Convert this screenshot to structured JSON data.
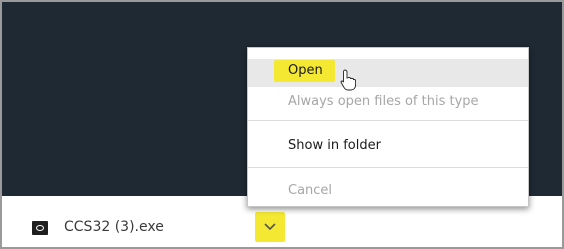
{
  "download": {
    "file_name": "CCS32 (3).exe",
    "file_icon": "exe-file-icon",
    "menu_toggle_icon": "chevron-down-icon"
  },
  "context_menu": {
    "open_label": "Open",
    "always_open_label": "Always open files of this type",
    "show_in_folder_label": "Show in folder",
    "cancel_label": "Cancel"
  },
  "colors": {
    "highlight": "#f4e833",
    "background_dark": "#1f2933",
    "disabled_text": "#a6a6a6"
  }
}
